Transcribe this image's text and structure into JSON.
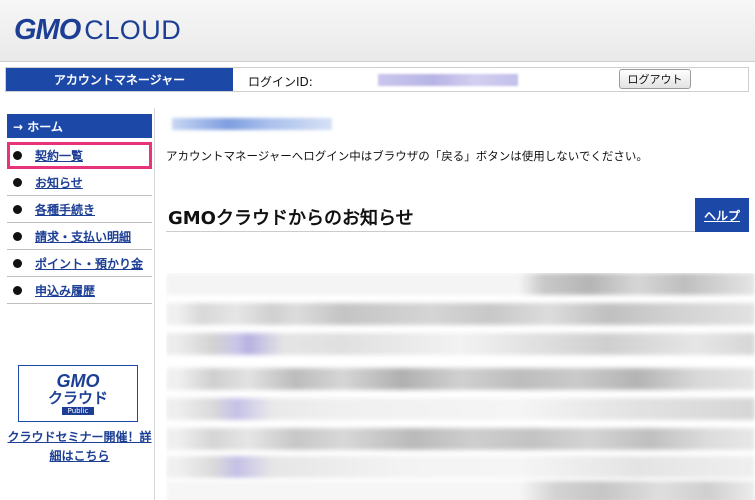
{
  "header": {
    "logo_gmo": "GMO",
    "logo_cloud": "CLOUD"
  },
  "account_bar": {
    "title": "アカウントマネージャー",
    "login_label": "ログインID:",
    "logout_label": "ログアウト"
  },
  "sidebar": {
    "home_label": "→ ホーム",
    "items": [
      {
        "label": "契約一覧",
        "highlighted": true
      },
      {
        "label": "お知らせ"
      },
      {
        "label": "各種手続き"
      },
      {
        "label": "請求・支払い明細"
      },
      {
        "label": "ポイント・預かり金"
      },
      {
        "label": "申込み履歴"
      }
    ],
    "banner": {
      "gmo": "GMO",
      "cloud": "クラウド",
      "public": "Public"
    },
    "seminar_line1": "クラウドセミナー開催！詳",
    "seminar_line2": "細はこちら"
  },
  "main": {
    "notice": "アカウントマネージャーへログイン中はブラウザの「戻る」ボタンは使用しないでください。",
    "news_title": "GMOクラウドからのお知らせ",
    "help_label": "ヘルプ"
  },
  "colors": {
    "brand_blue": "#1c48a8",
    "logo_blue": "#1c3f95",
    "highlight_pink": "#e8327a"
  }
}
